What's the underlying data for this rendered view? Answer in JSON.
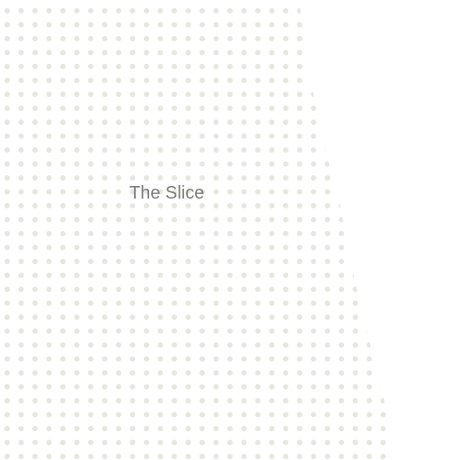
{
  "map": {
    "place_label": "The Slice",
    "colors": {
      "background": "#ffffff",
      "dot_fill": "#e7e6e0",
      "label_text": "#7c7c7c"
    }
  }
}
